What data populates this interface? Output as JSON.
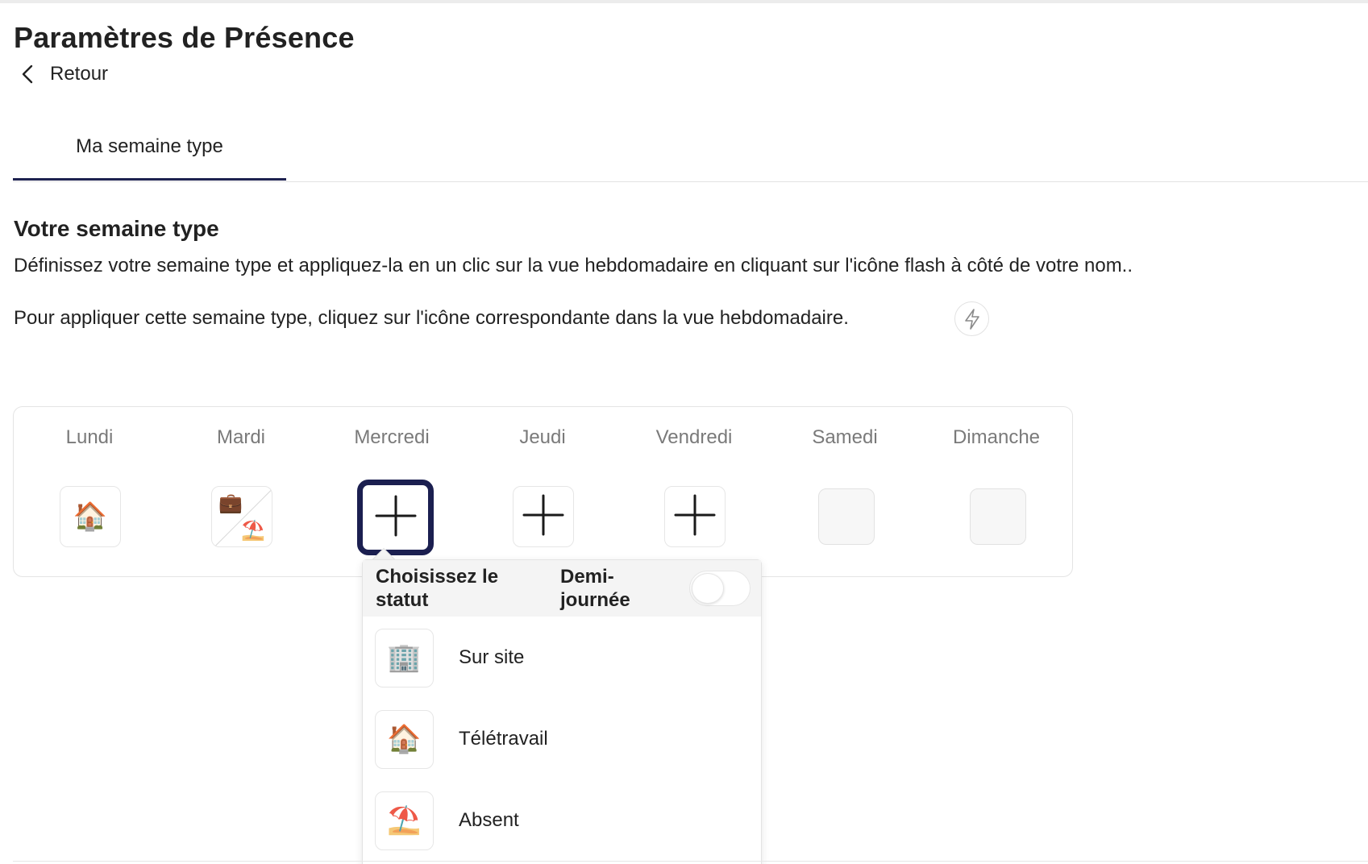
{
  "page": {
    "title": "Paramètres de Présence",
    "back_label": "Retour"
  },
  "tabs": [
    {
      "label": "Ma semaine type",
      "active": true
    }
  ],
  "section": {
    "title": "Votre semaine type",
    "description": "Définissez votre semaine type et appliquez-la en un clic sur la vue hebdomadaire en cliquant sur l'icône flash à côté de votre nom..",
    "hint": "Pour appliquer cette semaine type, cliquez sur l'icône correspondante dans la vue hebdomadaire.",
    "hint_icon": "lightning-icon"
  },
  "week": {
    "days": [
      {
        "label": "Lundi",
        "state": "teletravail",
        "icon": "🏠"
      },
      {
        "label": "Mardi",
        "state": "split",
        "icon_top": "💼",
        "icon_bottom": "⛱️"
      },
      {
        "label": "Mercredi",
        "state": "add",
        "selected": true,
        "icon": "plus-icon"
      },
      {
        "label": "Jeudi",
        "state": "add",
        "icon": "plus-icon"
      },
      {
        "label": "Vendredi",
        "state": "add",
        "icon": "plus-icon"
      },
      {
        "label": "Samedi",
        "state": "empty"
      },
      {
        "label": "Dimanche",
        "state": "empty"
      }
    ]
  },
  "status_popup": {
    "title": "Choisissez le statut",
    "half_day_label": "Demi-journée",
    "half_day_enabled": false,
    "options": [
      {
        "label": "Sur site",
        "icon": "🏢"
      },
      {
        "label": "Télétravail",
        "icon": "🏠"
      },
      {
        "label": "Absent",
        "icon": "⛱️"
      }
    ]
  },
  "colors": {
    "accent": "#1b1f50",
    "text": "#222222",
    "muted": "#7a7a7a",
    "border": "#e4e4e4"
  }
}
